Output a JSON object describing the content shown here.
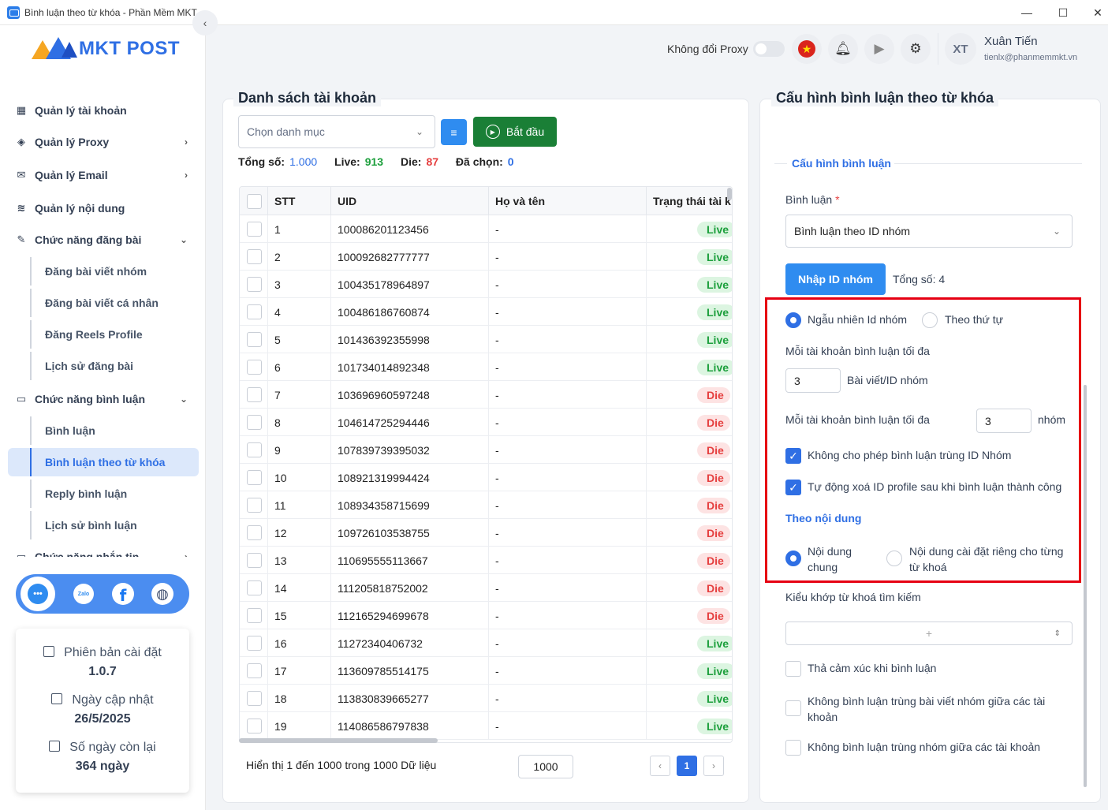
{
  "window": {
    "title": "Bình luận theo từ khóa - Phần Mềm MKT",
    "minimize": "—",
    "maximize": "☐",
    "close": "✕"
  },
  "brand": {
    "logo_text": "MKT POST"
  },
  "header": {
    "proxy_label": "Không đổi Proxy",
    "proxy_toggle_on": false,
    "user_initials": "XT",
    "user_name": "Xuân Tiến",
    "user_email": "tienlx@phanmemmkt.vn"
  },
  "sidebar": {
    "items": [
      {
        "label": "Quản lý tài khoản",
        "icon": "grid-icon",
        "chevron": ""
      },
      {
        "label": "Quản lý Proxy",
        "icon": "layers-icon",
        "chevron": "›"
      },
      {
        "label": "Quản lý Email",
        "icon": "mail-icon",
        "chevron": "›"
      },
      {
        "label": "Quản lý nội dung",
        "icon": "content-icon",
        "chevron": ""
      },
      {
        "label": "Chức năng đăng bài",
        "icon": "post-icon",
        "chevron": "⌄"
      },
      {
        "label": "Chức năng bình luận",
        "icon": "comment-icon",
        "chevron": "⌄"
      },
      {
        "label": "Chức năng nhắn tin",
        "icon": "chat-icon",
        "chevron": "›"
      }
    ],
    "post_subitems": [
      "Đăng bài viết nhóm",
      "Đăng bài viết cá nhân",
      "Đăng Reels Profile",
      "Lịch sử đăng bài"
    ],
    "comment_subitems": [
      "Bình luận",
      "Bình luận theo từ khóa",
      "Reply bình luận",
      "Lịch sử bình luận"
    ],
    "active_subitem": "Bình luận theo từ khóa",
    "social": {
      "zalo": "Zalo",
      "facebook": "f"
    },
    "info": {
      "version_label": "Phiên bản cài đặt",
      "version_value": "1.0.7",
      "update_label": "Ngày cập nhật",
      "update_value": "26/5/2025",
      "days_label": "Số ngày còn lại",
      "days_value": "364 ngày"
    }
  },
  "accounts": {
    "title": "Danh sách tài khoản",
    "category_placeholder": "Chọn danh mục",
    "start_label": "Bắt đầu",
    "stats": {
      "total_label": "Tổng số:",
      "total": "1.000",
      "live_label": "Live:",
      "live": "913",
      "die_label": "Die:",
      "die": "87",
      "selected_label": "Đã chọn:",
      "selected": "0"
    },
    "columns": [
      "STT",
      "UID",
      "Họ và tên",
      "Trạng thái tài k"
    ],
    "colors": {
      "live": "#1c9f3c",
      "die": "#e53e3e",
      "total": "#2f6fe4"
    },
    "rows": [
      {
        "stt": "1",
        "uid": "100086201123456",
        "name": "-",
        "status": "Live"
      },
      {
        "stt": "2",
        "uid": "100092682777777",
        "name": "-",
        "status": "Live"
      },
      {
        "stt": "3",
        "uid": "100435178964897",
        "name": "-",
        "status": "Live"
      },
      {
        "stt": "4",
        "uid": "100486186760874",
        "name": "-",
        "status": "Live"
      },
      {
        "stt": "5",
        "uid": "101436392355998",
        "name": "-",
        "status": "Live"
      },
      {
        "stt": "6",
        "uid": "101734014892348",
        "name": "-",
        "status": "Live"
      },
      {
        "stt": "7",
        "uid": "103696960597248",
        "name": "-",
        "status": "Die"
      },
      {
        "stt": "8",
        "uid": "104614725294446",
        "name": "-",
        "status": "Die"
      },
      {
        "stt": "9",
        "uid": "107839739395032",
        "name": "-",
        "status": "Die"
      },
      {
        "stt": "10",
        "uid": "108921319994424",
        "name": "-",
        "status": "Die"
      },
      {
        "stt": "11",
        "uid": "108934358715699",
        "name": "-",
        "status": "Die"
      },
      {
        "stt": "12",
        "uid": "109726103538755",
        "name": "-",
        "status": "Die"
      },
      {
        "stt": "13",
        "uid": "110695555113667",
        "name": "-",
        "status": "Die"
      },
      {
        "stt": "14",
        "uid": "111205818752002",
        "name": "-",
        "status": "Die"
      },
      {
        "stt": "15",
        "uid": "112165294699678",
        "name": "-",
        "status": "Die"
      },
      {
        "stt": "16",
        "uid": "11272340406732",
        "name": "-",
        "status": "Live"
      },
      {
        "stt": "17",
        "uid": "113609785514175",
        "name": "-",
        "status": "Live"
      },
      {
        "stt": "18",
        "uid": "113830839665277",
        "name": "-",
        "status": "Live"
      },
      {
        "stt": "19",
        "uid": "114086586797838",
        "name": "-",
        "status": "Live"
      }
    ],
    "pager_text": "Hiển thị 1 đến 1000 trong 1000 Dữ liệu",
    "page_size": "1000",
    "current_page": "1",
    "prev": "‹",
    "next": "›"
  },
  "config": {
    "title": "Cấu hình bình luận theo từ khóa",
    "section_title": "Cấu hình bình luận",
    "comment_label": "Bình luận",
    "required_mark": "*",
    "comment_type": "Bình luận theo ID nhóm",
    "import_button": "Nhập ID nhóm",
    "total_text": "Tổng số: 4",
    "order_random": "Ngẫu nhiên Id nhóm",
    "order_sequential": "Theo thứ tự",
    "order_selected": "random",
    "max_label_1": "Mỗi tài khoản bình luận tối đa",
    "max_value_1": "3",
    "max_unit_1": "Bài viết/ID nhóm",
    "max_label_2": "Mỗi tài khoản bình luận tối đa",
    "max_value_2": "3",
    "max_unit_2": "nhóm",
    "no_duplicate_group": "Không cho phép bình luận trùng ID Nhóm",
    "no_duplicate_group_checked": true,
    "auto_delete": "Tự động xoá ID profile sau khi bình luận thành công",
    "auto_delete_checked": true,
    "content_section": "Theo nội dung",
    "content_common": "Nội dung chung",
    "content_per_keyword": "Nội dung cài đặt riêng cho từng từ khoá",
    "content_selected": "common",
    "match_label": "Kiểu khớp từ khoá tìm kiếm",
    "match_value": "+",
    "react_label": "Thả cảm xúc khi bình luận",
    "react_checked": false,
    "no_dup_post_label": "Không bình luận trùng bài viết nhóm giữa các tài khoản",
    "no_dup_post_checked": false,
    "no_dup_group_acc_label": "Không bình luận trùng nhóm giữa các tài khoản",
    "no_dup_group_acc_checked": false,
    "highlight_color": "#e60012"
  }
}
